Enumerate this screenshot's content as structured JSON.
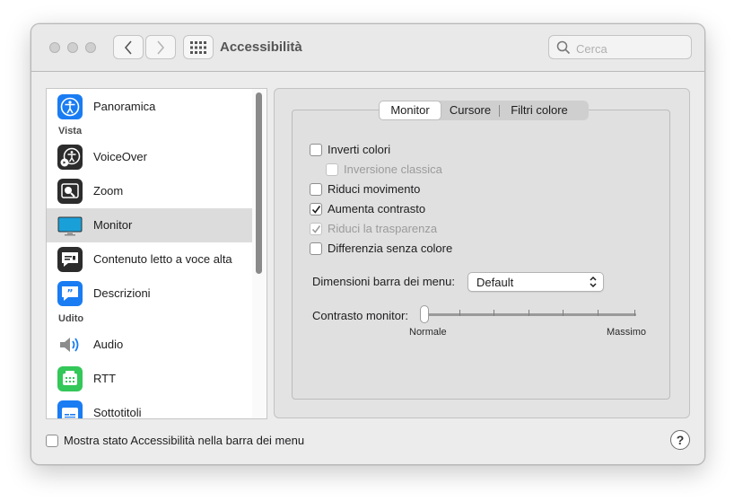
{
  "window": {
    "title": "Accessibilità",
    "search_placeholder": "Cerca"
  },
  "sidebar": {
    "items": [
      {
        "label": "Panoramica",
        "icon": "accessibility-icon",
        "color": "#1a7cf2"
      },
      {
        "header": "Vista"
      },
      {
        "label": "VoiceOver",
        "icon": "voiceover-icon",
        "color": "#2c2c2c"
      },
      {
        "label": "Zoom",
        "icon": "zoom-icon",
        "color": "#2c2c2c"
      },
      {
        "label": "Monitor",
        "icon": "display-icon",
        "color": "#1aa0d8",
        "selected": true
      },
      {
        "label": "Contenuto letto a voce alta",
        "icon": "spoken-content-icon",
        "color": "#2c2c2c"
      },
      {
        "label": "Descrizioni",
        "icon": "descriptions-icon",
        "color": "#1a7cf2"
      },
      {
        "header": "Udito"
      },
      {
        "label": "Audio",
        "icon": "speaker-icon",
        "color": "#8c8c8c"
      },
      {
        "label": "RTT",
        "icon": "rtt-icon",
        "color": "#34c759"
      },
      {
        "label": "Sottotitoli",
        "icon": "captions-icon",
        "color": "#1a7cf2"
      }
    ]
  },
  "tabs": [
    "Monitor",
    "Cursore",
    "Filtri colore"
  ],
  "active_tab": "Monitor",
  "options": [
    {
      "label": "Inverti colori",
      "checked": false,
      "enabled": true
    },
    {
      "label": "Inversione classica",
      "checked": false,
      "enabled": false
    },
    {
      "label": "Riduci movimento",
      "checked": false,
      "enabled": true
    },
    {
      "label": "Aumenta contrasto",
      "checked": true,
      "enabled": true
    },
    {
      "label": "Riduci la trasparenza",
      "checked": true,
      "enabled": false
    },
    {
      "label": "Differenzia senza colore",
      "checked": false,
      "enabled": true
    }
  ],
  "menu_bar_size": {
    "label": "Dimensioni barra dei menu:",
    "value": "Default"
  },
  "contrast": {
    "label": "Contrasto monitor:",
    "min_label": "Normale",
    "max_label": "Massimo",
    "value": 0
  },
  "footer": {
    "show_status_label": "Mostra stato Accessibilità nella barra dei menu",
    "show_status_checked": false,
    "help": "?"
  }
}
